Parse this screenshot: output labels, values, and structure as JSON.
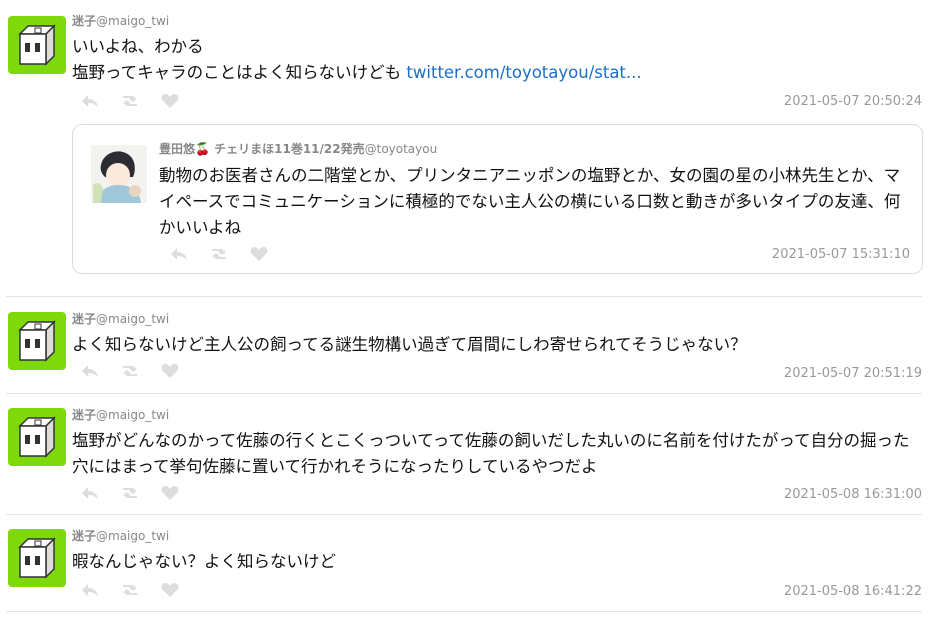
{
  "tweets": [
    {
      "display_name": "迷子",
      "handle": "@maigo_twi",
      "text": "いいよね、わかる\n塩野ってキャラのことはよく知らないけども ",
      "link": "twitter.com/toyotayou/stat...",
      "timestamp": "2021-05-07 20:50:24",
      "quote": {
        "display_name": "豊田悠🍒 チェリまほ11巻11/22発売",
        "handle": "@toyotayou",
        "text": "動物のお医者さんの二階堂とか、プリンタニアニッポンの塩野とか、女の園の星の小林先生とか、マイペースでコミュニケーションに積極的でない主人公の横にいる口数と動きが多いタイプの友達、何かいいよね",
        "timestamp": "2021-05-07 15:31:10"
      }
    },
    {
      "display_name": "迷子",
      "handle": "@maigo_twi",
      "text": "よく知らないけど主人公の飼ってる謎生物構い過ぎて眉間にしわ寄せられてそうじゃない？",
      "timestamp": "2021-05-07 20:51:19"
    },
    {
      "display_name": "迷子",
      "handle": "@maigo_twi",
      "text": "塩野がどんなのかって佐藤の行くとこくっついてって佐藤の飼いだした丸いのに名前を付けたがって自分の掘った穴にはまって挙句佐藤に置いて行かれそうになったりしているやつだよ",
      "timestamp": "2021-05-08 16:31:00"
    },
    {
      "display_name": "迷子",
      "handle": "@maigo_twi",
      "text": "暇なんじゃない？よく知らないけど",
      "timestamp": "2021-05-08 16:41:22"
    }
  ],
  "icons": {
    "reply": "reply-icon",
    "retweet": "retweet-icon",
    "like": "heart-icon"
  },
  "colors": {
    "avatar_bg": "#7fd80a",
    "link": "#1b6ec2",
    "icon_gray": "#dddddd"
  }
}
